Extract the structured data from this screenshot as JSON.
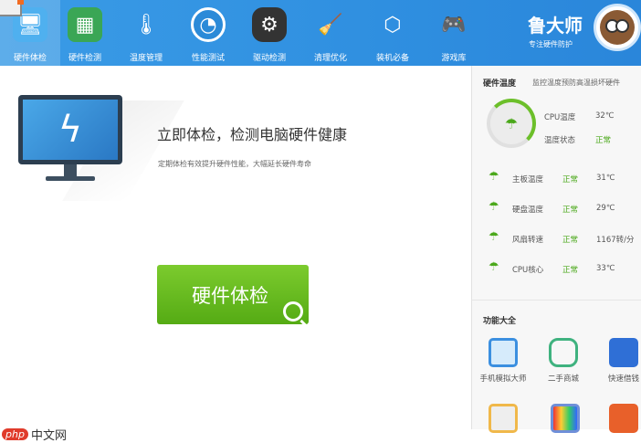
{
  "nav": [
    {
      "label": "硬件体检",
      "icon": "monitor-icon"
    },
    {
      "label": "硬件检测",
      "icon": "graphics-card-icon"
    },
    {
      "label": "温度管理",
      "icon": "thermometer-icon"
    },
    {
      "label": "性能测试",
      "icon": "speedometer-icon"
    },
    {
      "label": "驱动检测",
      "icon": "driver-gear-icon"
    },
    {
      "label": "清理优化",
      "icon": "broom-icon"
    },
    {
      "label": "装机必备",
      "icon": "box-icon"
    },
    {
      "label": "游戏库",
      "icon": "gamepad-icon"
    }
  ],
  "brand": {
    "name": "鲁大师",
    "tagline": "专注硬件防护"
  },
  "main": {
    "heading": "立即体检，检测电脑硬件健康",
    "subtext": "定期体检有效提升硬件性能，大幅延长硬件寿命",
    "button": "硬件体检"
  },
  "temp": {
    "title": "硬件温度",
    "desc": "监控温度预防高温损坏硬件",
    "cpu_label": "CPU温度",
    "cpu_value": "32℃",
    "status_label": "温度状态",
    "status_value": "正常",
    "rows": [
      {
        "name": "主板温度",
        "status": "正常",
        "value": "31℃"
      },
      {
        "name": "硬盘温度",
        "status": "正常",
        "value": "29℃"
      },
      {
        "name": "风扇转速",
        "status": "正常",
        "value": "1167转/分"
      },
      {
        "name": "CPU核心",
        "status": "正常",
        "value": "33℃"
      }
    ]
  },
  "features": {
    "title": "功能大全",
    "items": [
      {
        "label": "手机模拟大师"
      },
      {
        "label": "二手商城"
      },
      {
        "label": "快速借钱"
      }
    ]
  },
  "watermark": {
    "badge": "php",
    "text": "中文网"
  },
  "colors": {
    "topbar": "#2f8fe0",
    "green": "#5cb21a"
  }
}
